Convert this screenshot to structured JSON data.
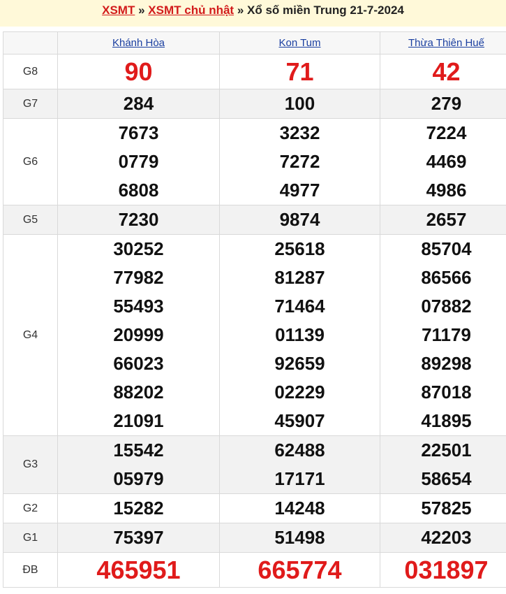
{
  "header": {
    "link1": "XSMT",
    "sep1": "»",
    "link2": "XSMT chủ nhật",
    "sep2": "»",
    "title": "Xổ số miền Trung 21-7-2024"
  },
  "columns": [
    "Khánh Hòa",
    "Kon Tum",
    "Thừa Thiên Huế"
  ],
  "prizes": [
    {
      "label": "G8",
      "values": [
        [
          "90"
        ],
        [
          "71"
        ],
        [
          "42"
        ]
      ]
    },
    {
      "label": "G7",
      "values": [
        [
          "284"
        ],
        [
          "100"
        ],
        [
          "279"
        ]
      ]
    },
    {
      "label": "G6",
      "values": [
        [
          "7673",
          "0779",
          "6808"
        ],
        [
          "3232",
          "7272",
          "4977"
        ],
        [
          "7224",
          "4469",
          "4986"
        ]
      ]
    },
    {
      "label": "G5",
      "values": [
        [
          "7230"
        ],
        [
          "9874"
        ],
        [
          "2657"
        ]
      ]
    },
    {
      "label": "G4",
      "values": [
        [
          "30252",
          "77982",
          "55493",
          "20999",
          "66023",
          "88202",
          "21091"
        ],
        [
          "25618",
          "81287",
          "71464",
          "01139",
          "92659",
          "02229",
          "45907"
        ],
        [
          "85704",
          "86566",
          "07882",
          "71179",
          "89298",
          "87018",
          "41895"
        ]
      ]
    },
    {
      "label": "G3",
      "values": [
        [
          "15542",
          "05979"
        ],
        [
          "62488",
          "17171"
        ],
        [
          "22501",
          "58654"
        ]
      ]
    },
    {
      "label": "G2",
      "values": [
        [
          "15282"
        ],
        [
          "14248"
        ],
        [
          "57825"
        ]
      ]
    },
    {
      "label": "G1",
      "values": [
        [
          "75397"
        ],
        [
          "51498"
        ],
        [
          "42203"
        ]
      ]
    },
    {
      "label": "ĐB",
      "values": [
        [
          "465951"
        ],
        [
          "665774"
        ],
        [
          "031897"
        ]
      ]
    }
  ],
  "colors": {
    "accent_red": "#e01b1b",
    "header_bg": "#fff9d9",
    "link_blue": "#1a3fa0"
  }
}
